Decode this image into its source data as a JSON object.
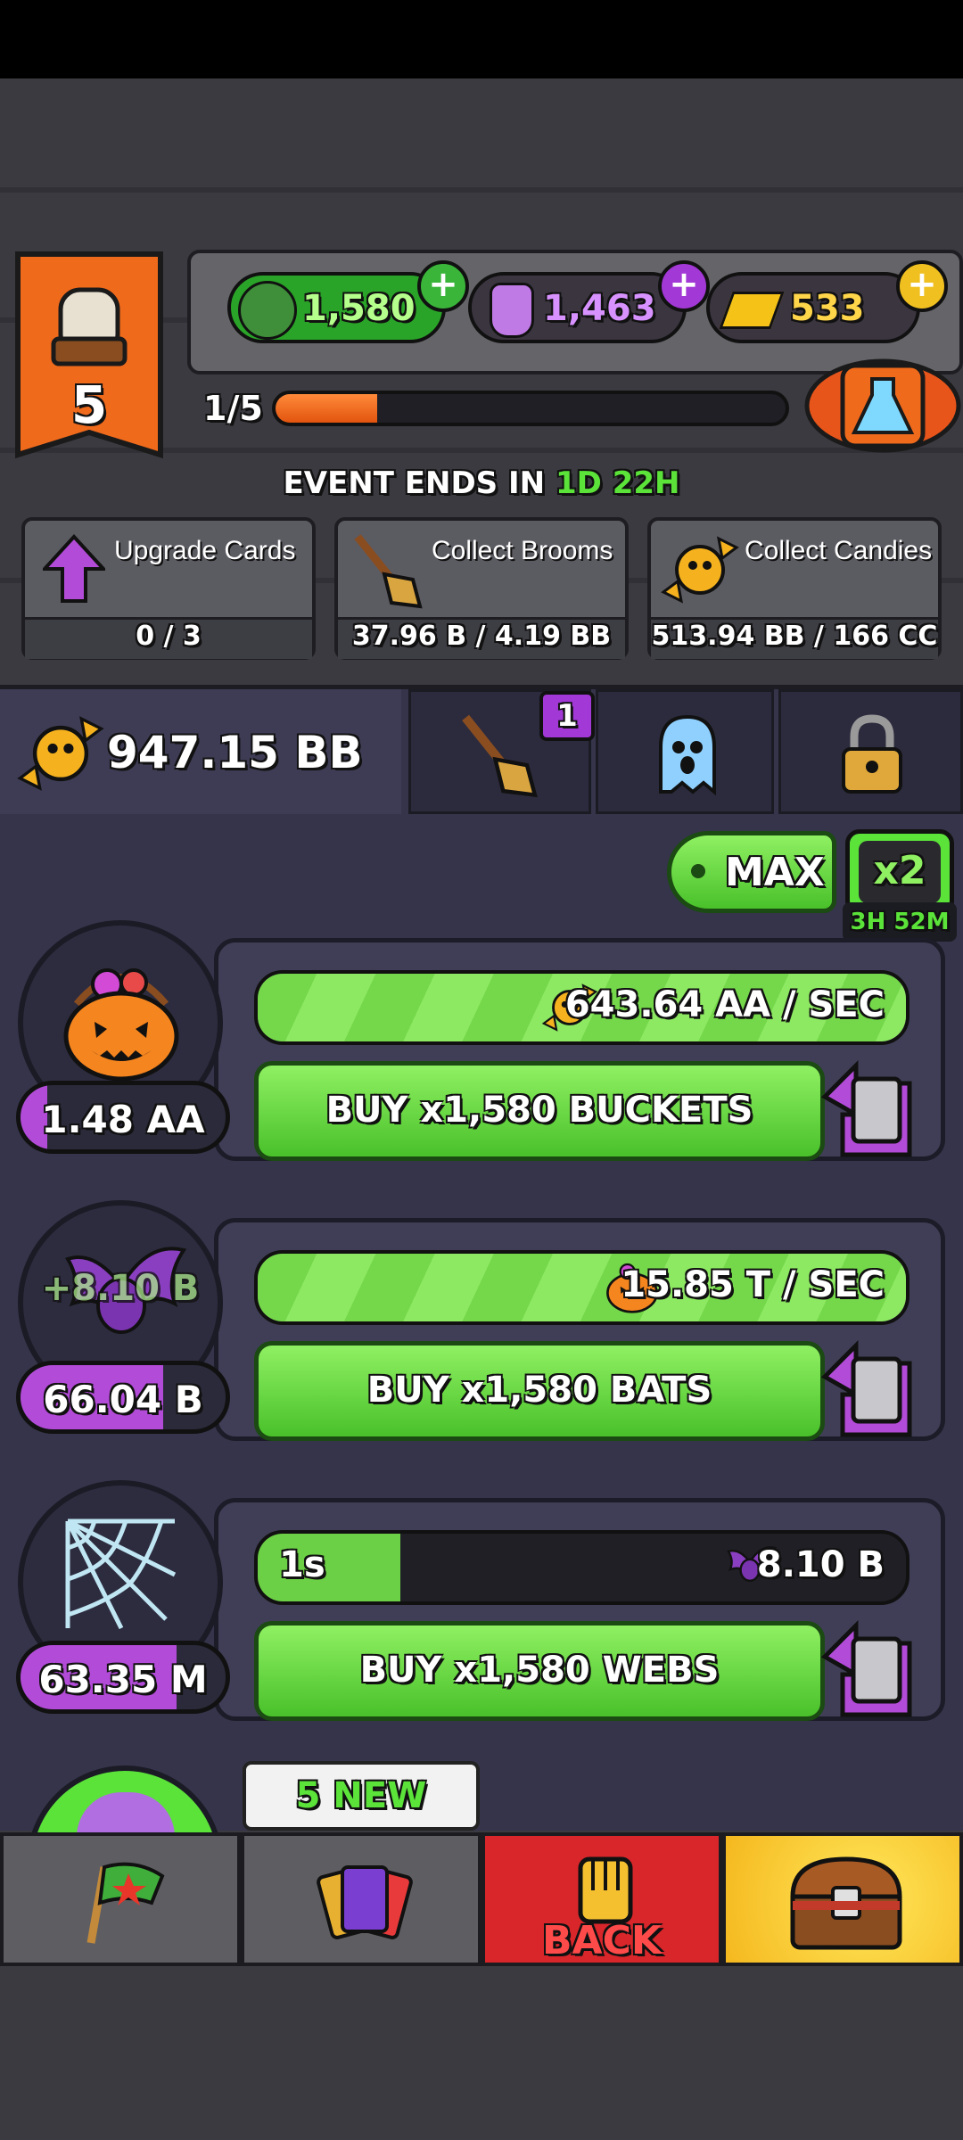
{
  "level": "5",
  "progress": {
    "label": "1/5",
    "fraction": 0.2
  },
  "currencies": [
    {
      "name": "goblin-currency",
      "value": "1,580"
    },
    {
      "name": "potion-currency",
      "value": "1,463"
    },
    {
      "name": "gold-currency",
      "value": "533"
    }
  ],
  "event": {
    "prefix": "EVENT ENDS IN ",
    "d": "1D",
    "h": "22H"
  },
  "quests": [
    {
      "title": "Upgrade Cards",
      "progress": "0 / 3"
    },
    {
      "title": "Collect Brooms",
      "progress": "37.96 B / 4.19 BB"
    },
    {
      "title": "Collect Candies",
      "progress": "513.94 BB / 166 CC"
    }
  ],
  "candy_total": "947.15 BB",
  "tabs": {
    "broom_badge": "1"
  },
  "max_label": "MAX",
  "boost": {
    "label": "x2",
    "timer": "3H 52M"
  },
  "generators": [
    {
      "name": "buckets",
      "count": "1.48 AA",
      "rate": "643.64 AA / SEC",
      "buy": "BUY x1,580 BUCKETS",
      "fill": 1.0
    },
    {
      "name": "bats",
      "count": "66.04 B",
      "floater": "+8.10 B",
      "rate": "15.85 T / SEC",
      "buy": "BUY x1,580 BATS",
      "fill": 1.0
    },
    {
      "name": "webs",
      "count": "63.35 M",
      "timer": "1s",
      "rate": "8.10 B",
      "buy": "BUY x1,580 WEBS",
      "fill": 0.22
    }
  ],
  "nav": {
    "new_badge": "5 NEW",
    "back": "BACK"
  },
  "colors": {
    "accent_green": "#5fd23a",
    "accent_purple": "#b24bd8",
    "banner_orange": "#f06a1c",
    "back_red": "#d8262b",
    "gold": "#f5c318"
  }
}
